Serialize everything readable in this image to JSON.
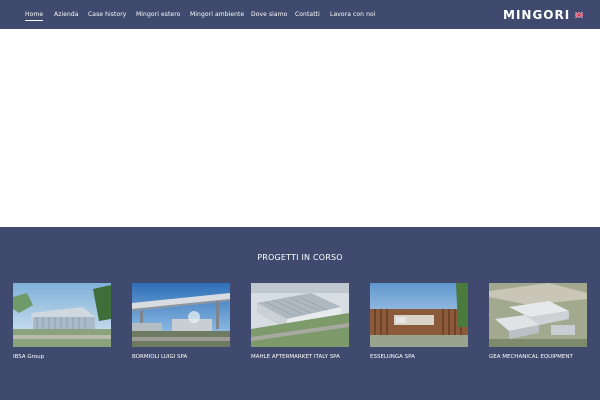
{
  "header": {
    "brand": "MINGORI",
    "nav": [
      {
        "label": "Home",
        "active": true
      },
      {
        "label": "Azienda"
      },
      {
        "label": "Case history"
      },
      {
        "label": "Mingori estero"
      },
      {
        "label": "Mingori ambiente"
      },
      {
        "label": "Dove siamo"
      },
      {
        "label": "Contatti"
      },
      {
        "label": "Lavora con noi"
      }
    ],
    "language_icon": "uk-flag-icon"
  },
  "projects": {
    "title": "PROGETTI IN CORSO",
    "items": [
      {
        "label": "IBSA Group"
      },
      {
        "label": "BORMIOLI LUIGI SPA"
      },
      {
        "label": "MAHLE AFTERMARKET ITALY SPA"
      },
      {
        "label": "ESSELUNGA SPA"
      },
      {
        "label": "GEA MECHANICAL EQUIPMENT"
      }
    ]
  },
  "colors": {
    "header_bg": "#3f4a6e",
    "section_bg": "#3f4a6e",
    "text": "#ffffff"
  }
}
